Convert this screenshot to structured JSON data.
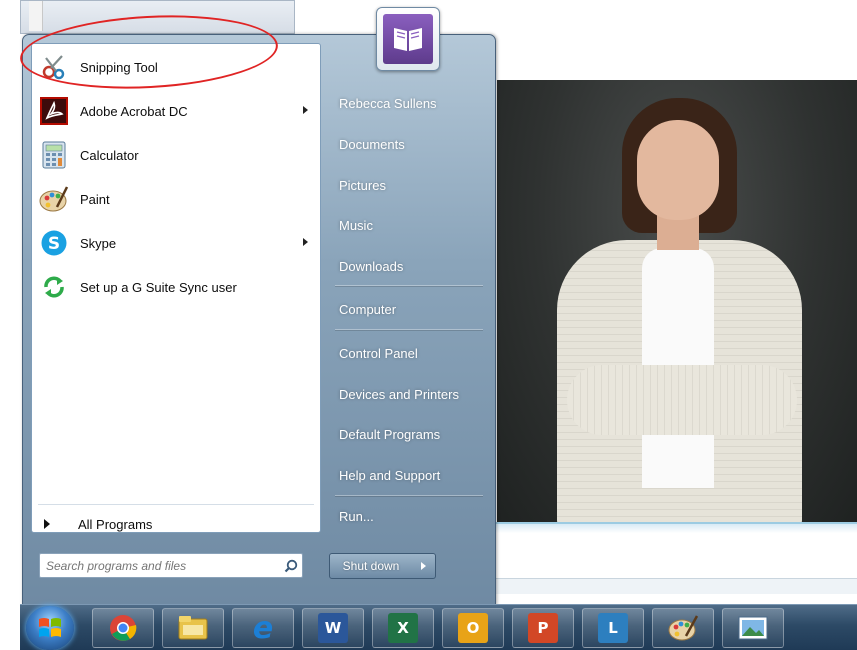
{
  "start_menu": {
    "pinned_programs": [
      {
        "label": "Snipping Tool",
        "icon": "scissors-icon",
        "has_submenu": false
      },
      {
        "label": "Adobe Acrobat DC",
        "icon": "acrobat-icon",
        "has_submenu": true
      },
      {
        "label": "Calculator",
        "icon": "calculator-icon",
        "has_submenu": false
      },
      {
        "label": "Paint",
        "icon": "paint-palette-icon",
        "has_submenu": false
      },
      {
        "label": "Skype",
        "icon": "skype-icon",
        "has_submenu": true
      },
      {
        "label": "Set up a G Suite Sync user",
        "icon": "sync-icon",
        "has_submenu": false
      }
    ],
    "all_programs_label": "All Programs",
    "search_placeholder": "Search programs and files",
    "right_pane": [
      "Rebecca Sullens",
      "Documents",
      "Pictures",
      "Music",
      "Downloads",
      "Computer",
      "Control Panel",
      "Devices and Printers",
      "Default Programs",
      "Help and Support",
      "Run..."
    ],
    "shutdown_label": "Shut down"
  },
  "annotation": {
    "color": "#e02424",
    "target": "Snipping Tool"
  },
  "taskbar": {
    "apps": [
      {
        "name": "chrome-icon",
        "letter": "",
        "color": "#db4437"
      },
      {
        "name": "file-explorer-icon",
        "letter": "",
        "color": "#e8c34a"
      },
      {
        "name": "internet-explorer-icon",
        "letter": "e",
        "color": "#1c7fd6"
      },
      {
        "name": "word-icon",
        "letter": "W",
        "color": "#2b579a"
      },
      {
        "name": "excel-icon",
        "letter": "X",
        "color": "#217346"
      },
      {
        "name": "outlook-icon",
        "letter": "O",
        "color": "#e8a317"
      },
      {
        "name": "powerpoint-icon",
        "letter": "P",
        "color": "#d24726"
      },
      {
        "name": "lync-icon",
        "letter": "L",
        "color": "#2d7fbf"
      },
      {
        "name": "paint-icon",
        "letter": "",
        "color": "#8ab4d8"
      },
      {
        "name": "photo-viewer-icon",
        "letter": "",
        "color": "#4a8ac7"
      }
    ]
  }
}
